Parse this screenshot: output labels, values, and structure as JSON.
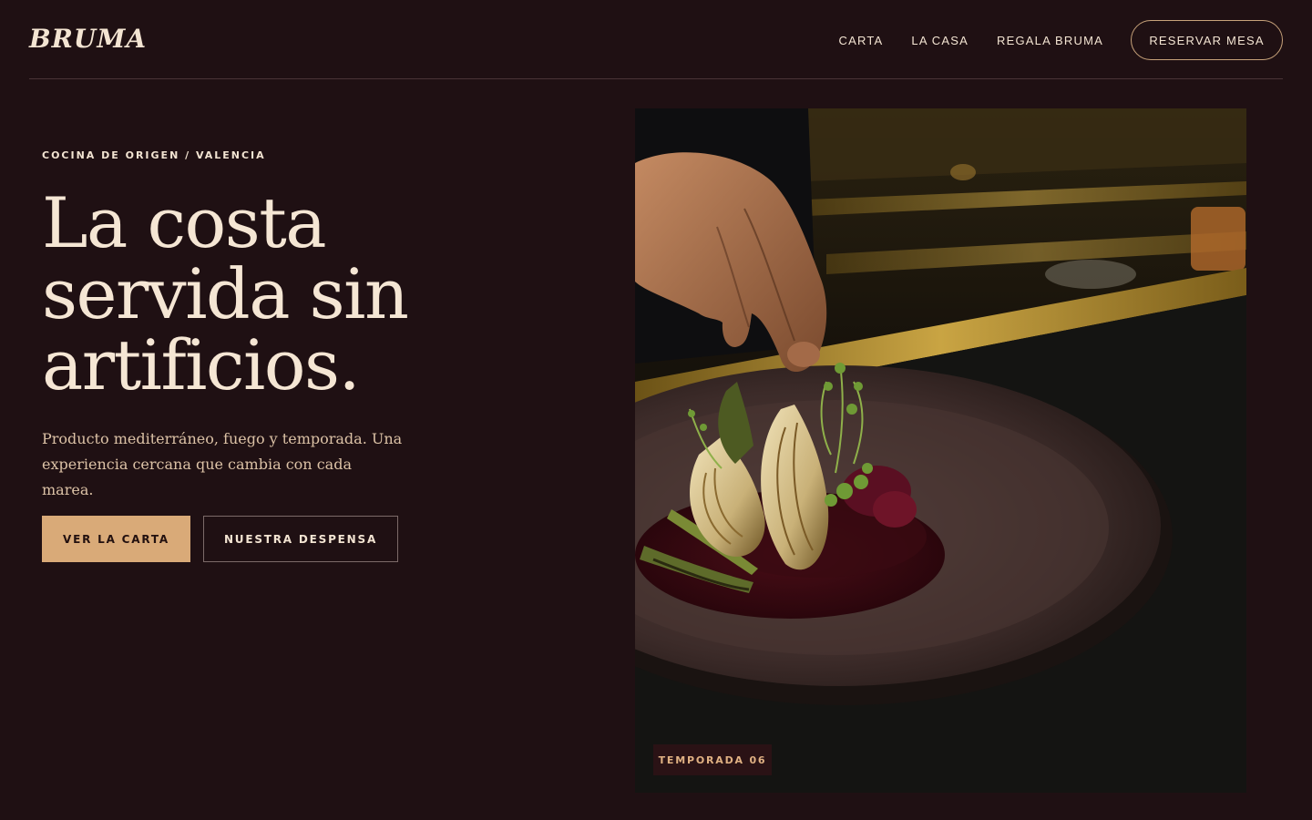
{
  "brand": {
    "name": "BRUMA"
  },
  "nav": {
    "items": [
      {
        "label": "CARTA"
      },
      {
        "label": "LA CASA"
      },
      {
        "label": "REGALA BRUMA"
      }
    ],
    "reserve_label": "RESERVAR MESA"
  },
  "hero": {
    "eyebrow": "COCINA DE ORIGEN / VALENCIA",
    "headline_lines": [
      "La costa",
      "servida sin",
      "artificios."
    ],
    "lead": "Producto mediterráneo, fuego y temporada. Una experiencia cercana que cambia con cada marea.",
    "primary_cta": "VER LA CARTA",
    "secondary_cta": "NUESTRA DESPENSA",
    "image_badge": "TEMPORADA 06"
  },
  "colors": {
    "background": "#1f1013",
    "text": "#f3e4d2",
    "accent": "#d9aa78",
    "muted_text": "#dcc2a6",
    "badge_bg": "#2a1215"
  }
}
